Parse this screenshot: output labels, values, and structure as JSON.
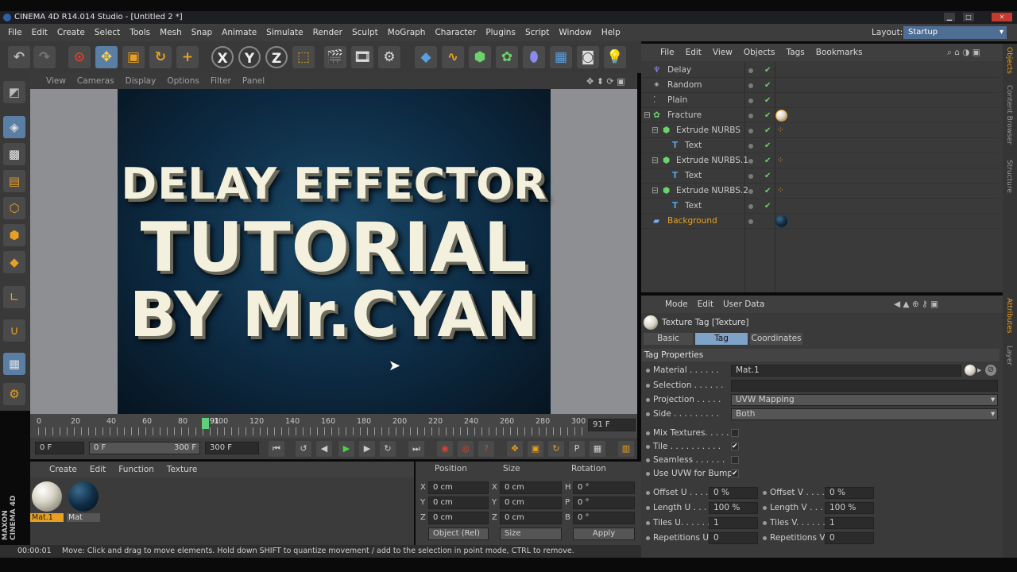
{
  "window": {
    "title": "CINEMA 4D R14.014 Studio - [Untitled 2 *]"
  },
  "menu": [
    "File",
    "Edit",
    "Create",
    "Select",
    "Tools",
    "Mesh",
    "Snap",
    "Animate",
    "Simulate",
    "Render",
    "Sculpt",
    "MoGraph",
    "Character",
    "Plugins",
    "Script",
    "Window",
    "Help"
  ],
  "layout": {
    "label": "Layout:",
    "value": "Startup"
  },
  "viewport_menu": [
    "View",
    "Cameras",
    "Display",
    "Options",
    "Filter",
    "Panel"
  ],
  "render_text": {
    "line1": "DELAY EFFECTOR",
    "line2": "TUTORIAL",
    "line3": "BY Mr.CYAN"
  },
  "timeline": {
    "ticks": [
      "0",
      "20",
      "40",
      "60",
      "80",
      "100",
      "120",
      "140",
      "160",
      "180",
      "200",
      "220",
      "240",
      "260",
      "280",
      "300"
    ],
    "current_frame": "91",
    "frame_field": "91 F"
  },
  "playbar": {
    "start": "0 F",
    "slider": "0 F",
    "end_inner": "300 F",
    "end": "300 F"
  },
  "material_menu": [
    "Create",
    "Edit",
    "Function",
    "Texture"
  ],
  "materials": [
    {
      "name": "Mat.1",
      "color": "#d8d5c6"
    },
    {
      "name": "Mat",
      "color": "#0f2f48"
    }
  ],
  "coords": {
    "headers": [
      "Position",
      "Size",
      "Rotation"
    ],
    "rows": [
      {
        "a": "X",
        "pos": "0 cm",
        "b": "X",
        "size": "0 cm",
        "c": "H",
        "rot": "0 °"
      },
      {
        "a": "Y",
        "pos": "0 cm",
        "b": "Y",
        "size": "0 cm",
        "c": "P",
        "rot": "0 °"
      },
      {
        "a": "Z",
        "pos": "0 cm",
        "b": "Z",
        "size": "0 cm",
        "c": "B",
        "rot": "0 °"
      }
    ],
    "mode": "Object (Rel)",
    "size_mode": "Size",
    "apply": "Apply"
  },
  "status": {
    "time": "00:00:01",
    "message": "Move: Click and drag to move elements. Hold down SHIFT to quantize movement / add to the selection in point mode, CTRL to remove."
  },
  "object_menu": [
    "File",
    "Edit",
    "View",
    "Objects",
    "Tags",
    "Bookmarks"
  ],
  "objects": [
    {
      "name": "Delay",
      "indent": 0,
      "icon": "effector-icon"
    },
    {
      "name": "Random",
      "indent": 0,
      "icon": "effector-icon"
    },
    {
      "name": "Plain",
      "indent": 0,
      "icon": "effector-icon"
    },
    {
      "name": "Fracture",
      "indent": 0,
      "icon": "fracture-icon"
    },
    {
      "name": "Extrude NURBS",
      "indent": 1,
      "icon": "extrude-icon"
    },
    {
      "name": "Text",
      "indent": 2,
      "icon": "text-icon"
    },
    {
      "name": "Extrude NURBS.1",
      "indent": 1,
      "icon": "extrude-icon"
    },
    {
      "name": "Text",
      "indent": 2,
      "icon": "text-icon"
    },
    {
      "name": "Extrude NURBS.2",
      "indent": 1,
      "icon": "extrude-icon"
    },
    {
      "name": "Text",
      "indent": 2,
      "icon": "text-icon"
    },
    {
      "name": "Background",
      "indent": 0,
      "icon": "background-icon"
    }
  ],
  "attr_menu": [
    "Mode",
    "Edit",
    "User Data"
  ],
  "attr": {
    "title": "Texture Tag [Texture]",
    "tabs": [
      "Basic",
      "Tag",
      "Coordinates"
    ],
    "section": "Tag Properties",
    "material_label": "Material . . . . . .",
    "material_value": "Mat.1",
    "selection_label": "Selection . . . . . .",
    "projection_label": "Projection . . . . .",
    "projection_value": "UVW Mapping",
    "side_label": "Side . . . . . . . . .",
    "side_value": "Both",
    "mix_label": "Mix Textures. . . . .",
    "tile_label": "Tile . . . . . . . . . .",
    "seamless_label": "Seamless . . . . . .",
    "uvwbump_label": "Use UVW for Bump",
    "offset_u_label": "Offset U . . . .",
    "offset_u": "0 %",
    "offset_v_label": "Offset V . . . .",
    "offset_v": "0 %",
    "length_u_label": "Length U . . . .",
    "length_u": "100 %",
    "length_v_label": "Length V . . . .",
    "length_v": "100 %",
    "tiles_u_label": "Tiles U. . . . . .",
    "tiles_u": "1",
    "tiles_v_label": "Tiles V. . . . . .",
    "tiles_v": "1",
    "rep_u_label": "Repetitions U",
    "rep_u": "0",
    "rep_v_label": "Repetitions V",
    "rep_v": "0"
  },
  "side_tabs": [
    "Objects",
    "Content Browser",
    "Structure",
    "Attributes",
    "Layer"
  ],
  "brand": {
    "line1": "MAXON",
    "line2": "CINEMA 4D"
  }
}
